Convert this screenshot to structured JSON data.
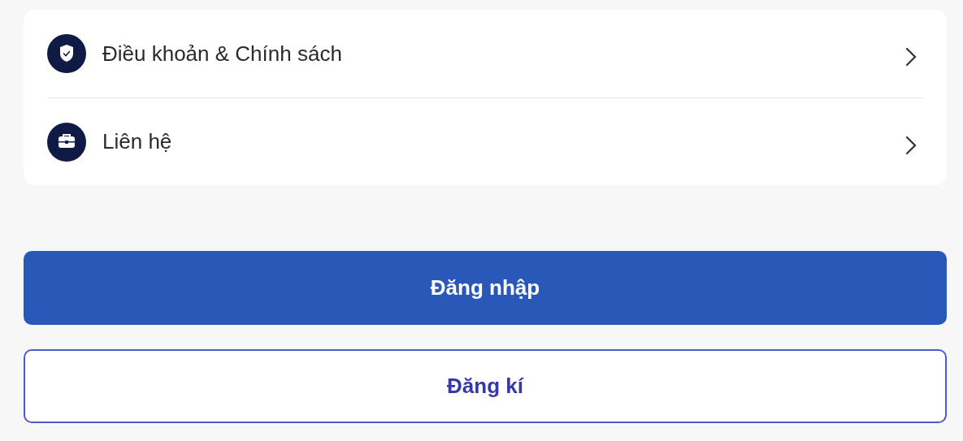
{
  "menu": {
    "items": [
      {
        "kind": "shield",
        "label": "Điều khoản & Chính sách"
      },
      {
        "kind": "briefcase",
        "label": "Liên hệ"
      }
    ]
  },
  "buttons": [
    {
      "kind": "primary",
      "label": "Đăng nhập"
    },
    {
      "kind": "outline",
      "label": "Đăng kí"
    }
  ]
}
